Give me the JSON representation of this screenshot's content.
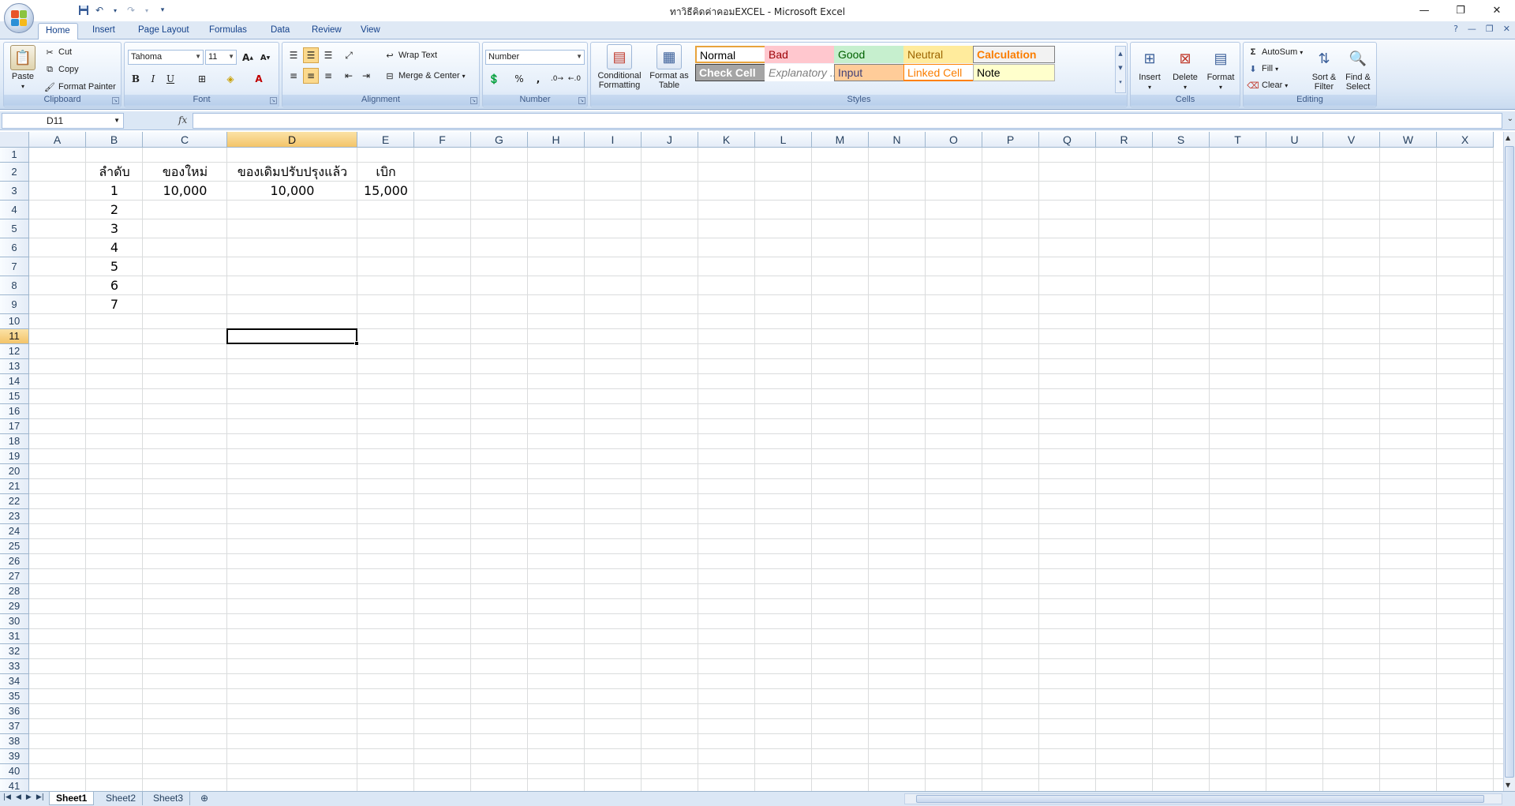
{
  "window": {
    "title": "ทาวิธีคิดค่าคอมEXCEL - Microsoft Excel",
    "controls": [
      "minimize",
      "restore",
      "close"
    ]
  },
  "ribbon": {
    "tabs": [
      "Home",
      "Insert",
      "Page Layout",
      "Formulas",
      "Data",
      "Review",
      "View"
    ],
    "active_tab": "Home",
    "clipboard": {
      "label": "Clipboard",
      "paste": "Paste",
      "cut": "Cut",
      "copy": "Copy",
      "format_painter": "Format Painter"
    },
    "font": {
      "label": "Font",
      "name": "Tahoma",
      "size": "11",
      "bold": "B",
      "italic": "I",
      "underline": "U",
      "grow": "A",
      "shrink": "A"
    },
    "alignment": {
      "label": "Alignment",
      "wrap_text": "Wrap Text",
      "merge_center": "Merge & Center"
    },
    "number": {
      "label": "Number",
      "format": "Number",
      "percent": "%",
      "comma": ","
    },
    "styles": {
      "label": "Styles",
      "conditional_formatting": "Conditional Formatting",
      "format_as_table": "Format as Table",
      "cells": [
        {
          "name": "Normal",
          "bg": "#ffffff",
          "fg": "#000000",
          "border": "#e8a33c"
        },
        {
          "name": "Bad",
          "bg": "#ffc7ce",
          "fg": "#9c0006",
          "border": "#ffc7ce"
        },
        {
          "name": "Good",
          "bg": "#c6efce",
          "fg": "#006100",
          "border": "#c6efce"
        },
        {
          "name": "Neutral",
          "bg": "#ffeb9c",
          "fg": "#9c6500",
          "border": "#ffeb9c"
        },
        {
          "name": "Calculation",
          "bg": "#f2f2f2",
          "fg": "#fa7d00",
          "border": "#7f7f7f"
        },
        {
          "name": "Check Cell",
          "bg": "#a5a5a5",
          "fg": "#ffffff",
          "border": "#3f3f3f"
        },
        {
          "name": "Explanatory ...",
          "bg": "#ffffff",
          "fg": "#7f7f7f",
          "border": "#ffffff"
        },
        {
          "name": "Input",
          "bg": "#ffcc99",
          "fg": "#3f3f76",
          "border": "#7f7f7f"
        },
        {
          "name": "Linked Cell",
          "bg": "#ffffff",
          "fg": "#fa7d00",
          "border": "#ff8001"
        },
        {
          "name": "Note",
          "bg": "#ffffcc",
          "fg": "#000000",
          "border": "#b2b2b2"
        }
      ]
    },
    "cells": {
      "label": "Cells",
      "insert": "Insert",
      "delete": "Delete",
      "format": "Format"
    },
    "editing": {
      "label": "Editing",
      "autosum": "AutoSum",
      "fill": "Fill",
      "clear": "Clear",
      "sort_filter": "Sort & Filter",
      "find_select": "Find & Select"
    }
  },
  "formula_bar": {
    "name_box": "D11",
    "fx": "fx",
    "content": ""
  },
  "sheet": {
    "columns": [
      "A",
      "B",
      "C",
      "D",
      "E",
      "F",
      "G",
      "H",
      "I",
      "J",
      "K",
      "L",
      "M",
      "N",
      "O",
      "P",
      "Q",
      "R",
      "S",
      "T",
      "U",
      "V",
      "W",
      "X"
    ],
    "rows": [
      "1",
      "2",
      "3",
      "4",
      "5",
      "6",
      "7",
      "8",
      "9",
      "10",
      "11",
      "12",
      "13",
      "14",
      "15",
      "16",
      "17",
      "18",
      "19",
      "20",
      "21",
      "22",
      "23",
      "24",
      "25",
      "26",
      "27",
      "28",
      "29",
      "30",
      "31",
      "32",
      "33",
      "34",
      "35",
      "36",
      "37",
      "38",
      "39",
      "40",
      "41"
    ],
    "selected_column": "D",
    "selected_row": "11",
    "cells": {
      "B2": "ลำดับ",
      "C2": "ของใหม่",
      "D2": "ของเดิมปรับปรุงแล้ว",
      "E2": "เบิก",
      "B3": "1",
      "C3": "10,000",
      "D3": "10,000",
      "E3": "15,000",
      "B4": "2",
      "B5": "3",
      "B6": "4",
      "B7": "5",
      "B8": "6",
      "B9": "7"
    }
  },
  "sheet_tabs": [
    "Sheet1",
    "Sheet2",
    "Sheet3"
  ],
  "active_sheet": "Sheet1"
}
